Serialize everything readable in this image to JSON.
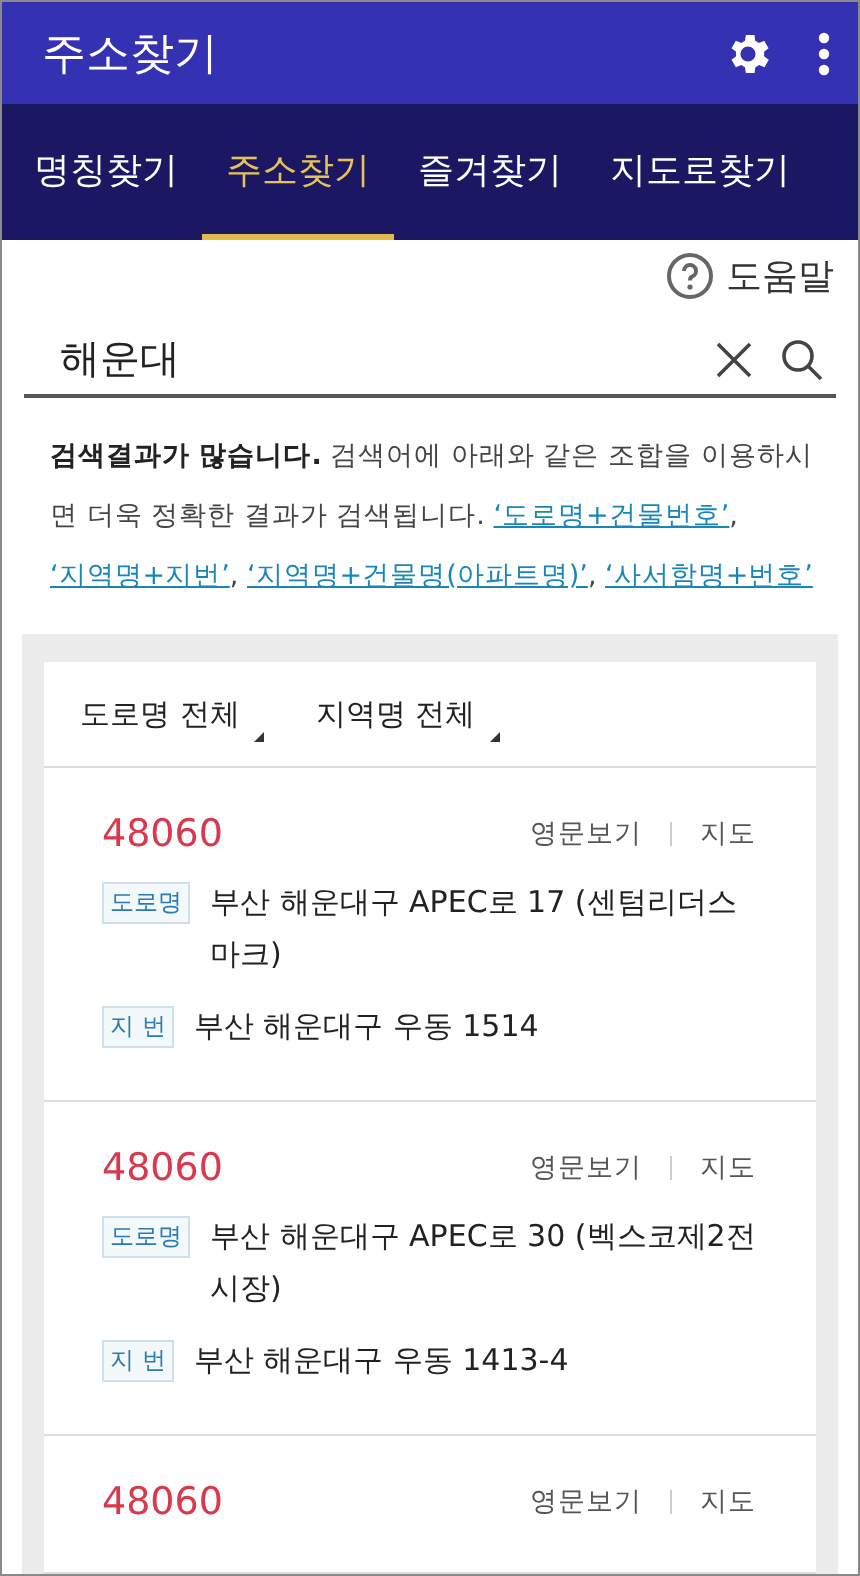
{
  "app_bar": {
    "title": "주소찾기"
  },
  "tabs": [
    {
      "label": "명칭찾기",
      "selected": false
    },
    {
      "label": "주소찾기",
      "selected": true
    },
    {
      "label": "즐겨찾기",
      "selected": false
    },
    {
      "label": "지도로찾기",
      "selected": false
    }
  ],
  "help": {
    "label": "도움말"
  },
  "search": {
    "value": "해운대"
  },
  "notice": {
    "text": "**검색결과가 많습니다.** 검색어에 아래와 같은 조합을 이용하시면 더욱 정확한 결과가 검색됩니다.",
    "links": [
      {
        "label": "‘도로명+건물번호’",
        "after": ","
      },
      {
        "label": "‘지역명+지번’",
        "after": ","
      },
      {
        "label": "‘지역명+건물명(아파트명)’",
        "after": ","
      },
      {
        "label": "‘사서함명+번호’"
      }
    ]
  },
  "filters": [
    {
      "label": "도로명 전체"
    },
    {
      "label": "지역명 전체"
    }
  ],
  "results": [
    {
      "zip": "48060",
      "english_link": "영문보기",
      "map_link": "지도",
      "addresses": [
        {
          "tag": "도로명",
          "text": "부산 해운대구 APEC로 17 (센텀리더스마크)"
        },
        {
          "tag": "지 번",
          "text": "부산 해운대구 우동 1514"
        }
      ]
    },
    {
      "zip": "48060",
      "english_link": "영문보기",
      "map_link": "지도",
      "addresses": [
        {
          "tag": "도로명",
          "text": "부산 해운대구 APEC로 30 (벡스코제2전시장)"
        },
        {
          "tag": "지 번",
          "text": "부산 해운대구 우동 1413-4"
        }
      ]
    },
    {
      "zip": "48060",
      "english_link": "영문보기",
      "map_link": "지도"
    }
  ]
}
